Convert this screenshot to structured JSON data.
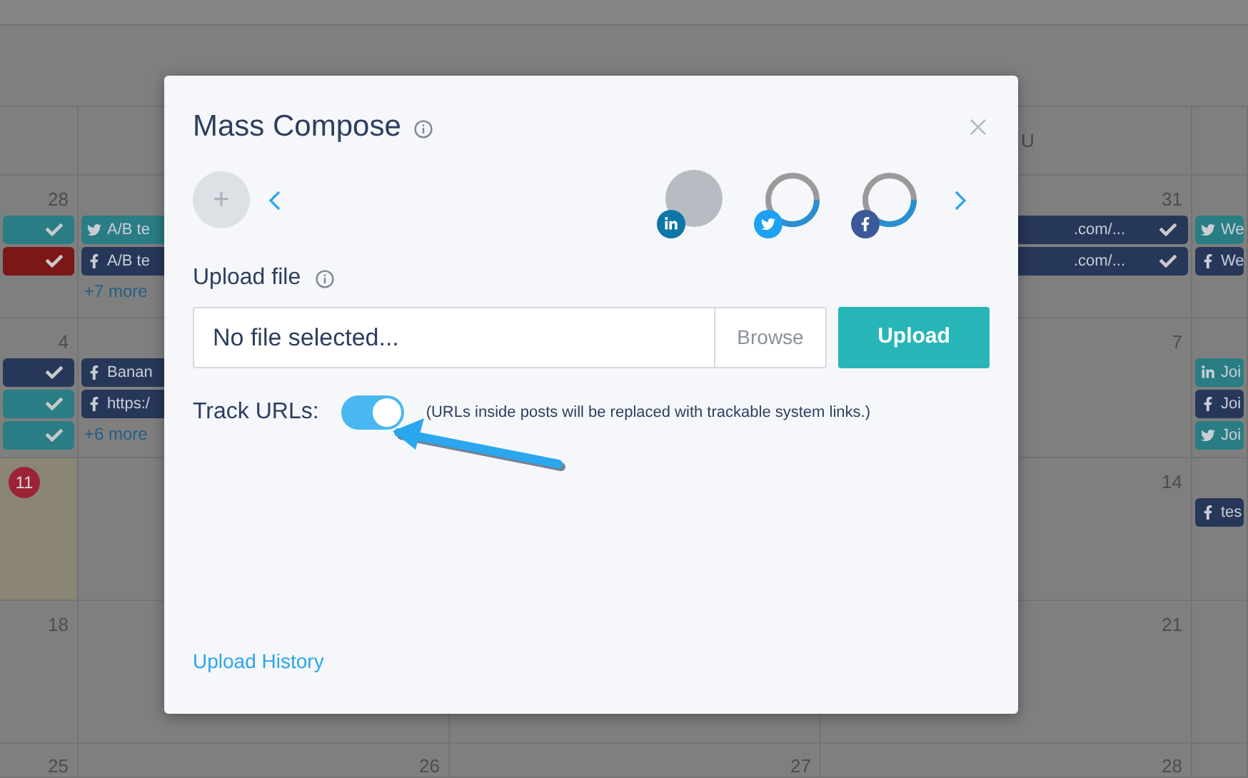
{
  "calendar": {
    "header": {
      "column_4": "U"
    },
    "weeks": [
      {
        "cells": [
          {
            "day": "28",
            "today": false,
            "chips": [
              {
                "kind": "plain",
                "color": "#2a7d84",
                "done": true
              },
              {
                "kind": "plain",
                "color": "#7c1717",
                "done": true
              }
            ]
          },
          {
            "chips": [
              {
                "kind": "twitter",
                "color": "#2a7d84",
                "text": "A/B te"
              },
              {
                "kind": "facebook",
                "color": "#27375a",
                "text": "A/B te"
              }
            ],
            "more": "+7 more"
          },
          {},
          {
            "day": "31",
            "today": false,
            "chips": [
              {
                "kind": "plain",
                "color": "#27375a",
                "text": ".com/...",
                "done": true
              },
              {
                "kind": "plain",
                "color": "#27375a",
                "text": ".com/...",
                "done": true
              }
            ]
          },
          {
            "chips": [
              {
                "kind": "twitter",
                "color": "#2a7d84",
                "text": "We"
              },
              {
                "kind": "facebook",
                "color": "#27375a",
                "text": "We"
              }
            ]
          }
        ]
      },
      {
        "cells": [
          {
            "day": "4",
            "today": false,
            "chips": [
              {
                "kind": "plain",
                "color": "#27375a",
                "done": true
              },
              {
                "kind": "plain",
                "color": "#2a7d84",
                "done": true
              },
              {
                "kind": "plain",
                "color": "#2a7d84",
                "done": true
              }
            ]
          },
          {
            "chips": [
              {
                "kind": "facebook",
                "color": "#27375a",
                "text": "Banan"
              },
              {
                "kind": "facebook",
                "color": "#27375a",
                "text": "https:/"
              }
            ],
            "more": "+6 more"
          },
          {},
          {
            "day": "7",
            "today": false
          },
          {
            "chips": [
              {
                "kind": "linkedin",
                "color": "#2a7d84",
                "text": "Joi"
              },
              {
                "kind": "facebook",
                "color": "#27375a",
                "text": "Joi"
              },
              {
                "kind": "twitter",
                "color": "#2a7d84",
                "text": "Joi"
              }
            ]
          }
        ]
      },
      {
        "cells": [
          {
            "day": "11",
            "today": true
          },
          {},
          {},
          {
            "day": "14",
            "today": false
          },
          {
            "chips": [
              {
                "kind": "facebook",
                "color": "#27375a",
                "text": "tes"
              }
            ]
          }
        ]
      },
      {
        "cells": [
          {
            "day": "18",
            "today": false
          },
          {},
          {},
          {
            "day": "21",
            "today": false
          },
          {}
        ]
      },
      {
        "cells": [
          {
            "day": "25",
            "today": false
          },
          {
            "day": "26",
            "today": false
          },
          {
            "day": "27",
            "today": false
          },
          {
            "day": "28",
            "today": false
          },
          {}
        ]
      }
    ]
  },
  "dialog": {
    "title": "Mass Compose",
    "add_button": "+",
    "accounts": [
      {
        "kind": "linkedin",
        "loading": false
      },
      {
        "kind": "twitter",
        "loading": true
      },
      {
        "kind": "facebook",
        "loading": true
      }
    ],
    "upload_label": "Upload file",
    "file_field": {
      "placeholder": "No file selected..."
    },
    "browse_button": "Browse",
    "upload_button": "Upload",
    "track_urls": {
      "label": "Track URLs:",
      "on": true,
      "hint": "(URLs inside posts will be replaced with trackable system links.)"
    },
    "upload_history_link": "Upload History"
  }
}
